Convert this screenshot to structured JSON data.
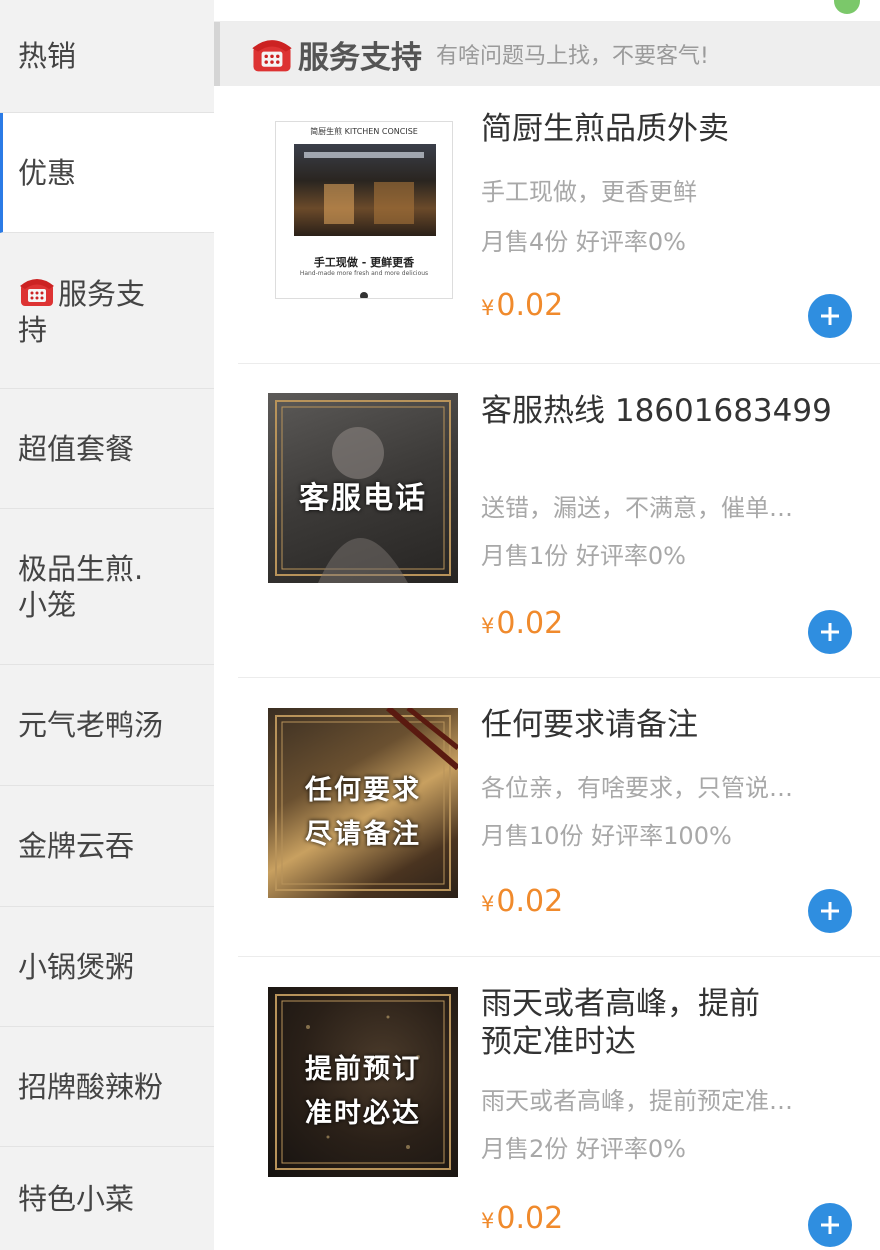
{
  "sidebar": {
    "items": [
      {
        "label": "热销",
        "active": false
      },
      {
        "label": "优惠",
        "active": true
      },
      {
        "label": "服务支持",
        "icon": "telephone-icon",
        "active": false
      },
      {
        "label": "超值套餐",
        "active": false
      },
      {
        "label": "极品生煎.小笼",
        "active": false
      },
      {
        "label": "元气老鸭汤",
        "active": false
      },
      {
        "label": "金牌云吞",
        "active": false
      },
      {
        "label": "小锅煲粥",
        "active": false
      },
      {
        "label": "招牌酸辣粉",
        "active": false
      },
      {
        "label": "特色小菜",
        "active": false
      }
    ]
  },
  "section": {
    "title": "服务支持",
    "subtitle": "有啥问题马上找，不要客气!",
    "icon": "telephone-icon"
  },
  "products": [
    {
      "name": "简厨生煎品质外卖",
      "desc": "手工现做，更香更鲜",
      "sales": "月售4份 好评率0%",
      "price_symbol": "¥",
      "price": "0.02",
      "image": {
        "brand": "简厨生煎 KITCHEN CONCISE",
        "caption": "手工现做 - 更鲜更香",
        "caption_en": "Hand-made more fresh and more delicious"
      }
    },
    {
      "name": "客服热线 18601683499",
      "desc": "送错，漏送，不满意，催单…",
      "sales": "月售1份 好评率0%",
      "price_symbol": "¥",
      "price": "0.02",
      "image": {
        "caption": "客服电话"
      }
    },
    {
      "name": "任何要求请备注",
      "desc": "各位亲，有啥要求，只管说…",
      "sales": "月售10份 好评率100%",
      "price_symbol": "¥",
      "price": "0.02",
      "image": {
        "caption_line1": "任何要求",
        "caption_line2": "尽请备注"
      }
    },
    {
      "name": "雨天或者高峰，提前预定准时达",
      "desc": "雨天或者高峰，提前预定准…",
      "sales": "月售2份 好评率0%",
      "price_symbol": "¥",
      "price": "0.02",
      "image": {
        "caption_line1": "提前预订",
        "caption_line2": "准时必达"
      }
    }
  ],
  "colors": {
    "accent_blue": "#2f8ee0",
    "price_orange": "#f08a2c",
    "gold_frame": "#b8935a"
  }
}
